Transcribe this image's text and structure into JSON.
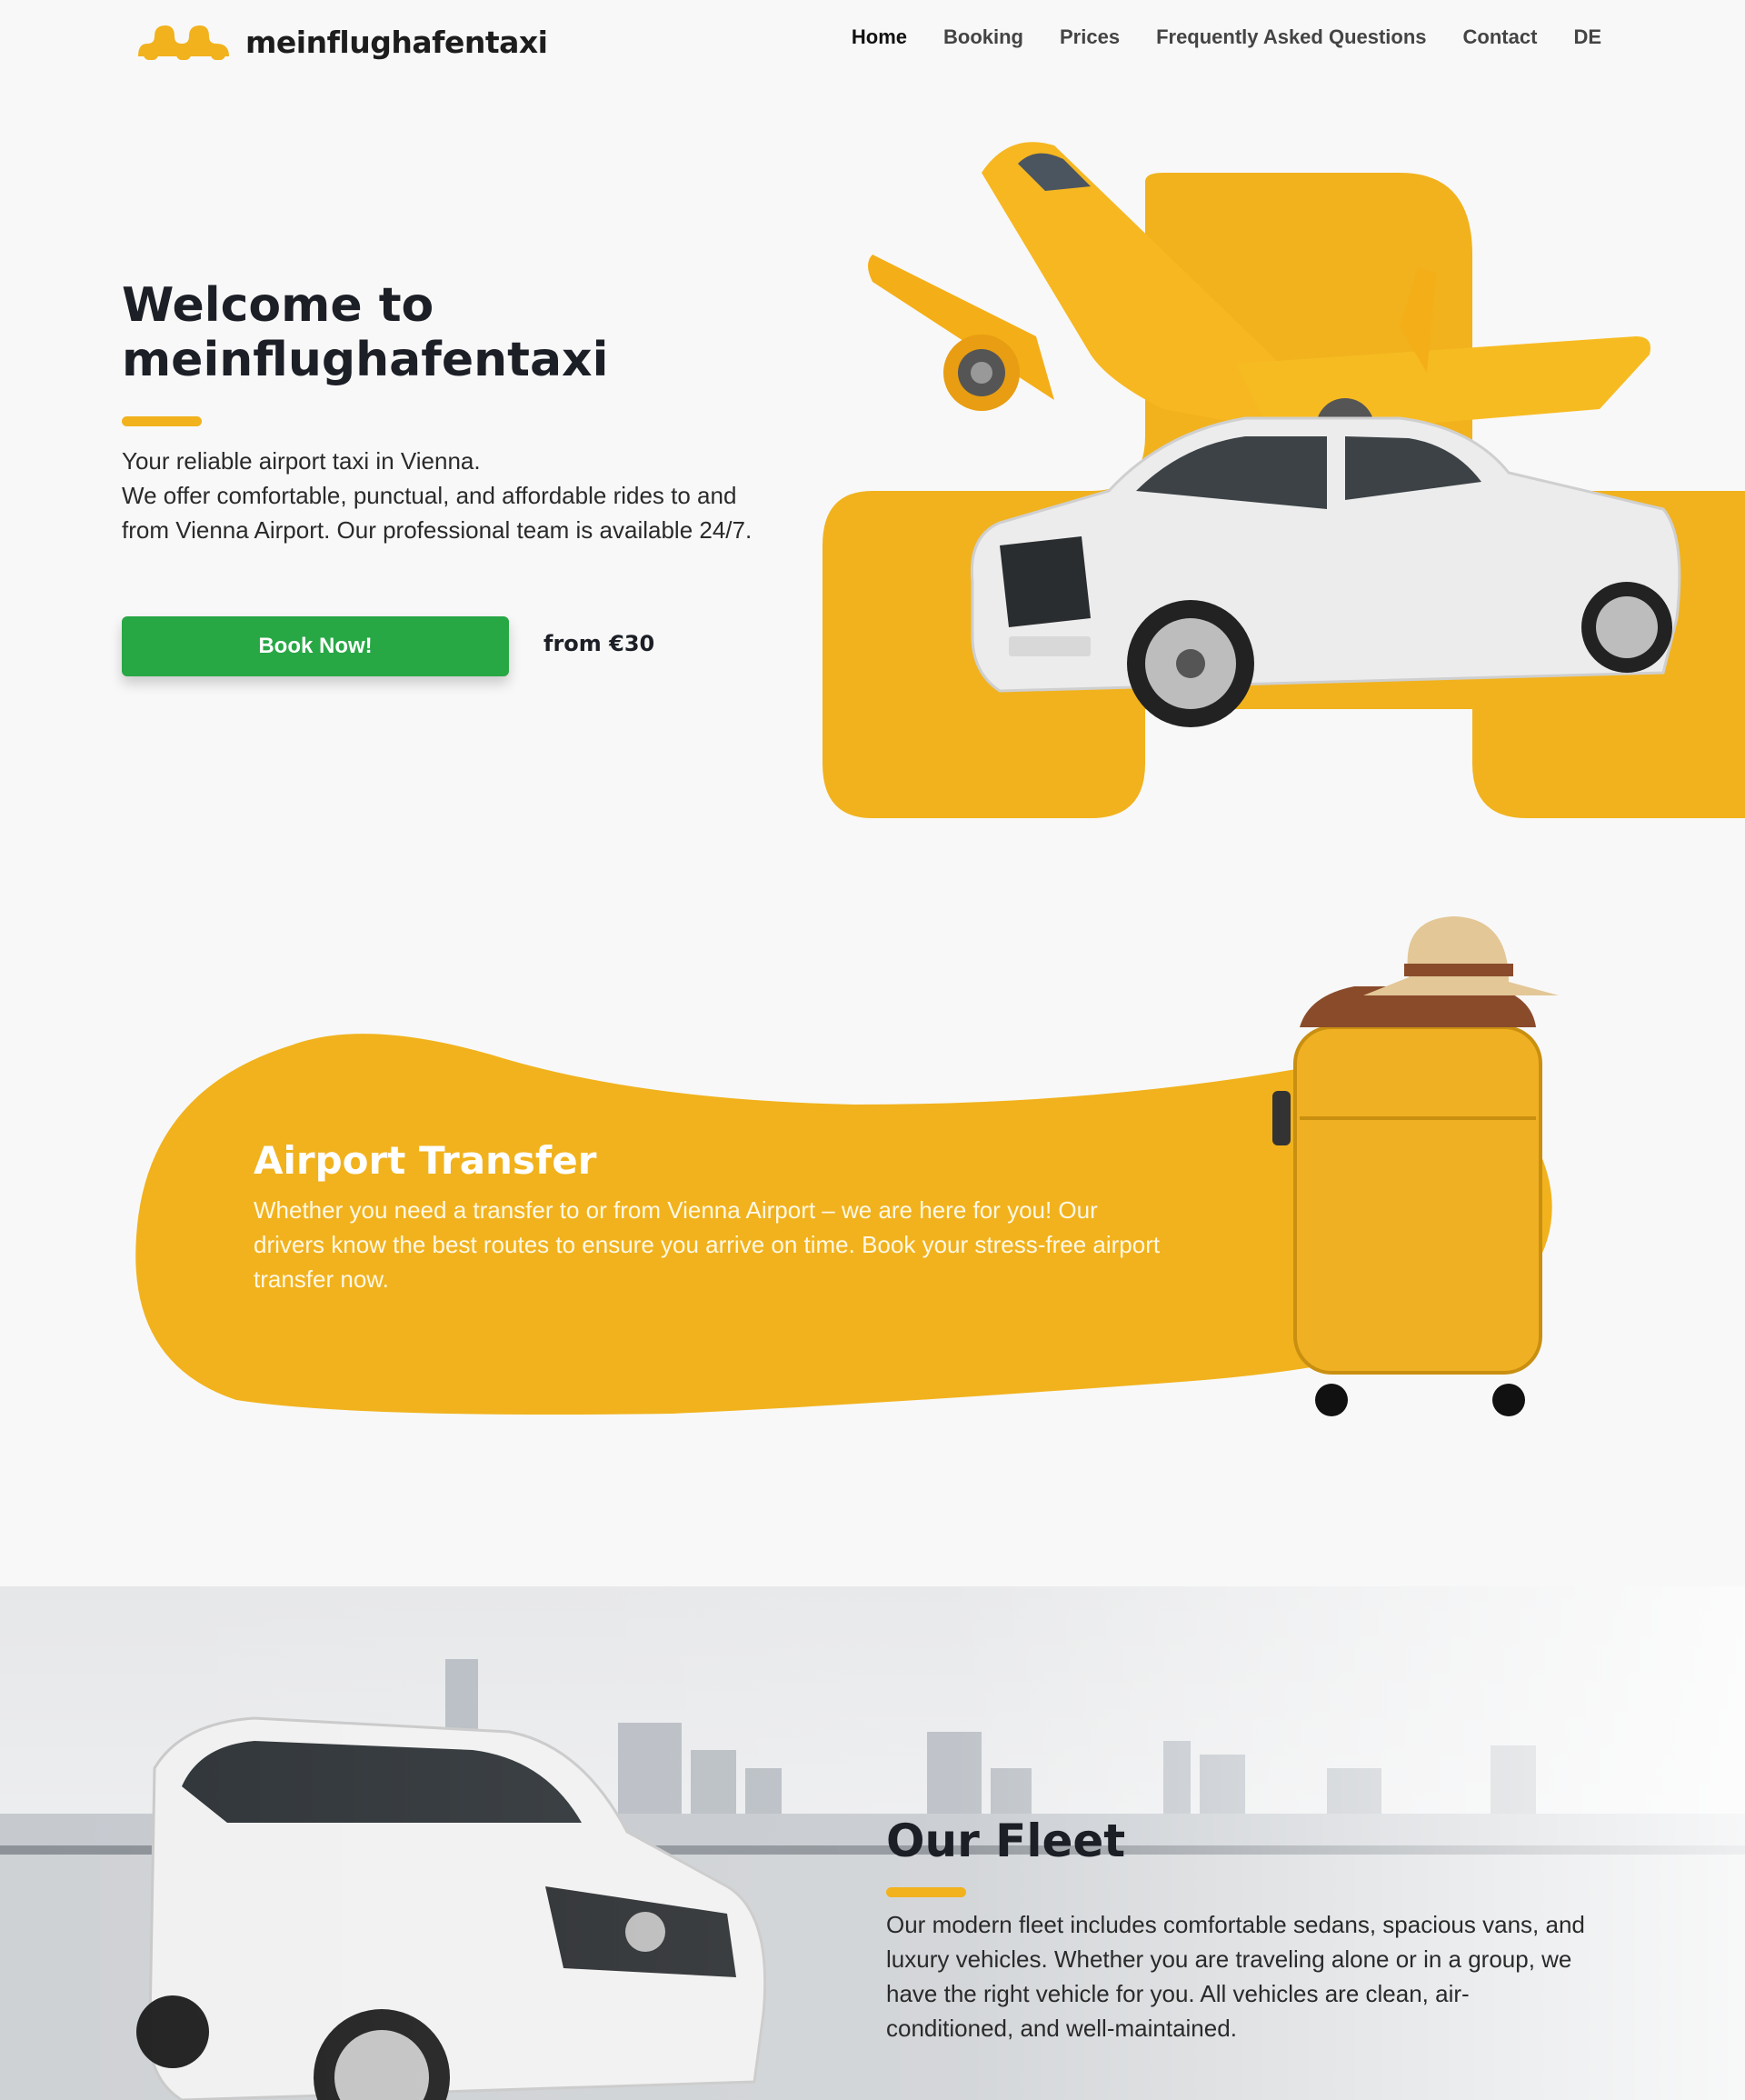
{
  "nav": {
    "brand": "meinflughafentaxi",
    "items": [
      {
        "label": "Home",
        "active": true
      },
      {
        "label": "Booking"
      },
      {
        "label": "Prices"
      },
      {
        "label": "Frequently Asked Questions"
      },
      {
        "label": "Contact"
      },
      {
        "label": "DE"
      }
    ]
  },
  "hero": {
    "title": "Welcome to meinflughafentaxi",
    "text_line1": "Your reliable airport taxi in Vienna.",
    "text_line2": "We offer comfortable, punctual, and affordable rides to and from Vienna Airport. Our professional team is available 24/7.",
    "cta": "Book Now!",
    "price": "from €30"
  },
  "transfer": {
    "title": "Airport Transfer",
    "text": "Whether you need a transfer to or from Vienna Airport – we are here for you! Our drivers know the best routes to ensure you arrive on time. Book your stress-free airport transfer now."
  },
  "fleet": {
    "title": "Our Fleet",
    "text": "Our modern fleet includes comfortable sedans, spacious vans, and luxury vehicles. Whether you are traveling alone or in a group, we have the right vehicle for you. All vehicles are clean, air-conditioned, and well-maintained."
  },
  "colors": {
    "accent": "#f1b21d",
    "cta": "#28a745",
    "dark": "#1c1f26",
    "background": "#f8f8f8"
  }
}
